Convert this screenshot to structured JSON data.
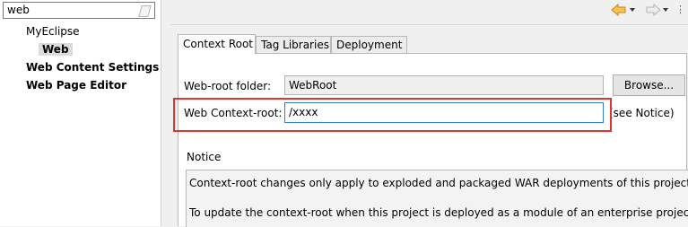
{
  "sidebar": {
    "filter_value": "web",
    "items": [
      {
        "label": "MyEclipse"
      },
      {
        "label": "Web"
      },
      {
        "label": "Web Content Settings"
      },
      {
        "label": "Web Page Editor"
      }
    ]
  },
  "toolbar": {
    "back_icon": "back-arrow-icon",
    "forward_icon": "forward-arrow-icon",
    "menu_glyph": "⋮"
  },
  "tabs": [
    {
      "label": "Context Root",
      "active": true
    },
    {
      "label": "Tag Libraries",
      "active": false
    },
    {
      "label": "Deployment",
      "active": false
    }
  ],
  "form": {
    "webroot_label": "Web-root folder:",
    "webroot_value": "WebRoot",
    "browse_label": "Browse...",
    "context_label": "Web Context-root:",
    "context_value": "/xxxx",
    "see_notice": "(see Notice)"
  },
  "notice": {
    "title": "Notice",
    "line1": "Context-root changes only apply to exploded and packaged WAR deployments of this project.",
    "line2": "To update the context-root when this project is deployed as a module of an enterprise project"
  },
  "colors": {
    "highlight": "#e0352f",
    "focus_border": "#2d7fd0",
    "nav_arrow": "#e8a23a"
  }
}
